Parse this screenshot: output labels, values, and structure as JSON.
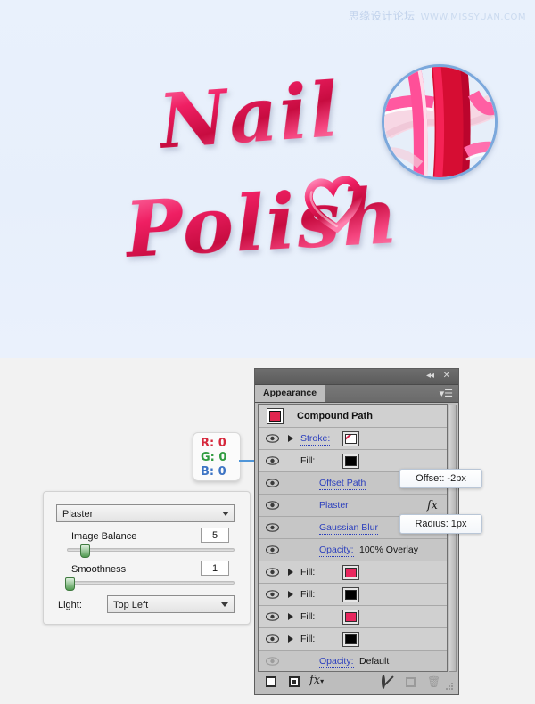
{
  "artwork": {
    "watermark_cn": "思缘设计论坛",
    "watermark_url": "WWW.MISSYUAN.COM",
    "title_line1": "Nail",
    "title_line2": "Polish",
    "background_color": "#e8f0fb",
    "text_color": "#e01a55"
  },
  "plaster_dialog": {
    "effect_name": "Plaster",
    "image_balance_label": "Image Balance",
    "image_balance_value": "5",
    "smoothness_label": "Smoothness",
    "smoothness_value": "1",
    "light_label": "Light:",
    "light_value": "Top Left"
  },
  "rgb_tooltip": {
    "r": "R: 0",
    "g": "G: 0",
    "b": "B: 0",
    "r_color": "#d6283c",
    "g_color": "#2f9b3f",
    "b_color": "#3d74c4"
  },
  "appearance_panel": {
    "tab_label": "Appearance",
    "object_title": "Compound Path",
    "collapse_icon": "◂◂",
    "close_icon": "✕",
    "menu_icon": "▾☰",
    "rows": [
      {
        "id": "stroke",
        "label": "Stroke:",
        "value": "",
        "link": true,
        "eye": "on",
        "disclosure": true,
        "swatch": "stroke-none",
        "indent": 0,
        "fx": false,
        "alt": false
      },
      {
        "id": "fill-main",
        "label": "Fill:",
        "value": "",
        "link": false,
        "eye": "on",
        "disclosure": false,
        "swatch": "#000000",
        "indent": 0,
        "fx": false,
        "alt": false
      },
      {
        "id": "offset-path",
        "label": "Offset Path",
        "value": "",
        "link": true,
        "eye": "on",
        "disclosure": false,
        "swatch": "none",
        "indent": 1,
        "fx": false,
        "alt": true
      },
      {
        "id": "plaster",
        "label": "Plaster",
        "value": "",
        "link": true,
        "eye": "on",
        "disclosure": false,
        "swatch": "none",
        "indent": 1,
        "fx": true,
        "alt": true
      },
      {
        "id": "gaussian-blur",
        "label": "Gaussian Blur",
        "value": "",
        "link": true,
        "eye": "on",
        "disclosure": false,
        "swatch": "none",
        "indent": 1,
        "fx": false,
        "alt": true
      },
      {
        "id": "opacity-overlay",
        "label": "Opacity:",
        "value": "100% Overlay",
        "link": true,
        "eye": "on",
        "disclosure": false,
        "swatch": "none",
        "indent": 1,
        "fx": false,
        "alt": true
      },
      {
        "id": "fill-1",
        "label": "Fill:",
        "value": "",
        "link": false,
        "eye": "on",
        "disclosure": true,
        "swatch": "#e8275e",
        "indent": 0,
        "fx": false,
        "alt": false
      },
      {
        "id": "fill-2",
        "label": "Fill:",
        "value": "",
        "link": false,
        "eye": "on",
        "disclosure": true,
        "swatch": "#000000",
        "indent": 0,
        "fx": false,
        "alt": false
      },
      {
        "id": "fill-3",
        "label": "Fill:",
        "value": "",
        "link": false,
        "eye": "on",
        "disclosure": true,
        "swatch": "#e8275e",
        "indent": 0,
        "fx": false,
        "alt": false
      },
      {
        "id": "fill-4",
        "label": "Fill:",
        "value": "",
        "link": false,
        "eye": "on",
        "disclosure": true,
        "swatch": "#000000",
        "indent": 0,
        "fx": false,
        "alt": false
      },
      {
        "id": "opacity-default",
        "label": "Opacity:",
        "value": "Default",
        "link": true,
        "eye": "off",
        "disclosure": false,
        "swatch": "none",
        "indent": 1,
        "fx": false,
        "alt": true
      }
    ],
    "footer": {
      "new_stroke": "new-stroke",
      "new_fill": "new-fill",
      "add_effect": "fx",
      "clear_appearance": "clear-appearance",
      "duplicate_item": "duplicate-item",
      "delete_item": "delete-item"
    }
  },
  "callouts": {
    "offset": "Offset: -2px",
    "radius": "Radius: 1px"
  }
}
